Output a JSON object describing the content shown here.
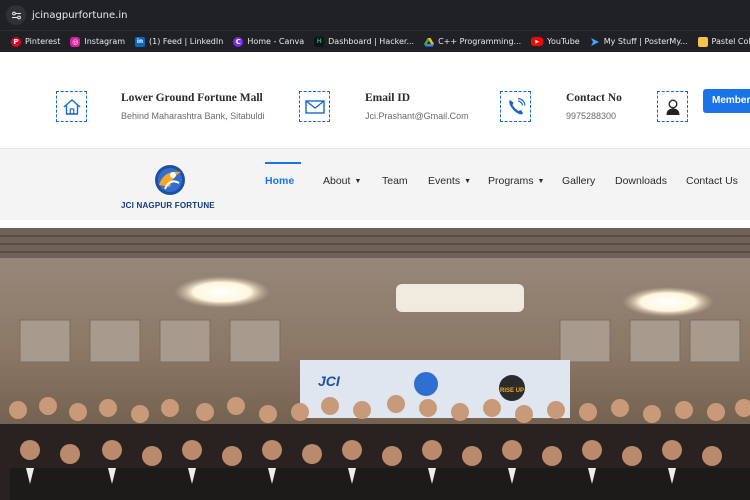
{
  "browser": {
    "url": "jcinagpurfortune.in",
    "bookmarks": [
      {
        "label": "Pinterest",
        "icon": "pinterest-icon",
        "color": "#e60023"
      },
      {
        "label": "Instagram",
        "icon": "instagram-icon",
        "color": "#d6249f"
      },
      {
        "label": "(1) Feed | LinkedIn",
        "icon": "linkedin-icon",
        "color": "#0a66c2"
      },
      {
        "label": "Home - Canva",
        "icon": "canva-icon",
        "color": "#7d2ae8"
      },
      {
        "label": "Dashboard | Hacker...",
        "icon": "hackerrank-icon",
        "color": "#1ba94c"
      },
      {
        "label": "C++ Programming...",
        "icon": "drive-icon",
        "color": "#fbbc04"
      },
      {
        "label": "YouTube",
        "icon": "youtube-icon",
        "color": "#ff0000"
      },
      {
        "label": "My Stuff | PosterMy...",
        "icon": "postermywall-icon",
        "color": "#3ea6ff"
      },
      {
        "label": "Pastel Color Palettes...",
        "icon": "palette-icon",
        "color": "#f2c14e"
      }
    ]
  },
  "topbar": {
    "address_title": "Lower Ground Fortune Mall",
    "address_sub": "Behind Maharashtra Bank, Sitabuldi",
    "email_title": "Email ID",
    "email_sub": "Jci.Prashant@Gmail.Com",
    "phone_title": "Contact No",
    "phone_sub": "9975288300",
    "member_label": "Member"
  },
  "logo": {
    "text": "JCI NAGPUR FORTUNE"
  },
  "nav": {
    "items": [
      {
        "label": "Home",
        "has_dropdown": false,
        "active": true
      },
      {
        "label": "About",
        "has_dropdown": true
      },
      {
        "label": "Team",
        "has_dropdown": false
      },
      {
        "label": "Events",
        "has_dropdown": true
      },
      {
        "label": "Programs",
        "has_dropdown": true
      },
      {
        "label": "Gallery",
        "has_dropdown": false
      },
      {
        "label": "Downloads",
        "has_dropdown": false
      },
      {
        "label": "Contact Us",
        "has_dropdown": false
      }
    ]
  },
  "hero": {
    "banner_left": "JCI",
    "banner_right": "RISE UP"
  },
  "colors": {
    "accent": "#1a73e8",
    "logo_navy": "#123a7a"
  }
}
